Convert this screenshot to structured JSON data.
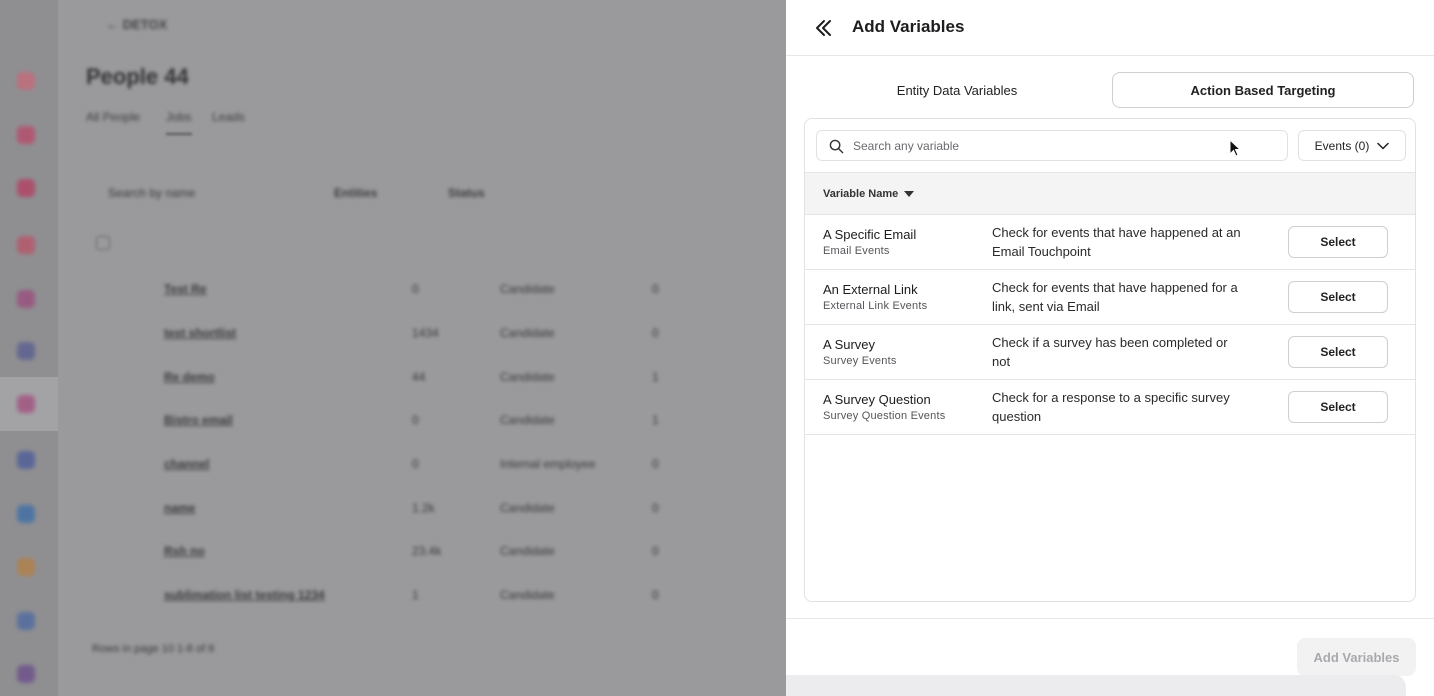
{
  "background": {
    "back_label": "← DETOX",
    "page_title": "People 44",
    "tabs": [
      "All People",
      "Jobs",
      "Leads"
    ],
    "search_placeholder": "Search by name",
    "filters": [
      "Entities",
      "Status"
    ],
    "rows": [
      {
        "name": "Test Re",
        "count": "0",
        "status": "Candidate",
        "value": "0"
      },
      {
        "name": "test shortlist",
        "count": "1434",
        "status": "Candidate",
        "value": "0"
      },
      {
        "name": "Re demo",
        "count": "44",
        "status": "Candidate",
        "value": "1"
      },
      {
        "name": "Bistro email",
        "count": "0",
        "status": "Candidate",
        "value": "1"
      },
      {
        "name": "channel",
        "count": "0",
        "status": "Internal employee",
        "value": "0"
      },
      {
        "name": "name",
        "count": "1.2k",
        "status": "Candidate",
        "value": "0"
      },
      {
        "name": "Rsh no",
        "count": "23.4k",
        "status": "Candidate",
        "value": "0"
      },
      {
        "name": "sublimation list testing 1234",
        "count": "1",
        "status": "Candidate",
        "value": "0"
      }
    ],
    "pagination": "Rows in page  10  1-8 of 8"
  },
  "drawer": {
    "title": "Add Variables",
    "tabs": {
      "entity": "Entity Data Variables",
      "action": "Action Based Targeting"
    },
    "search": {
      "placeholder": "Search any variable",
      "value": ""
    },
    "events_dropdown": "Events (0)",
    "column_header": "Variable Name",
    "rows": [
      {
        "name": "A Specific Email",
        "sub": "Email Events",
        "desc": "Check for events that have happened at an Email Touchpoint",
        "button": "Select"
      },
      {
        "name": "An External Link",
        "sub": "External Link Events",
        "desc": "Check for events that have happened for a link, sent via Email",
        "button": "Select"
      },
      {
        "name": "A Survey",
        "sub": "Survey Events",
        "desc": "Check if a survey has been completed or not",
        "button": "Select"
      },
      {
        "name": "A Survey Question",
        "sub": "Survey Question Events",
        "desc": "Check for a response to a specific survey question",
        "button": "Select"
      }
    ],
    "add_button": "Add Variables"
  },
  "colors": {
    "overlay": "#9a9a9d",
    "drawer_bg": "#ffffff",
    "border": "#e2e2e5",
    "header_bg": "#f4f4f5",
    "disabled_btn_bg": "#f2f2f3",
    "disabled_btn_text": "#a9a9ad"
  }
}
